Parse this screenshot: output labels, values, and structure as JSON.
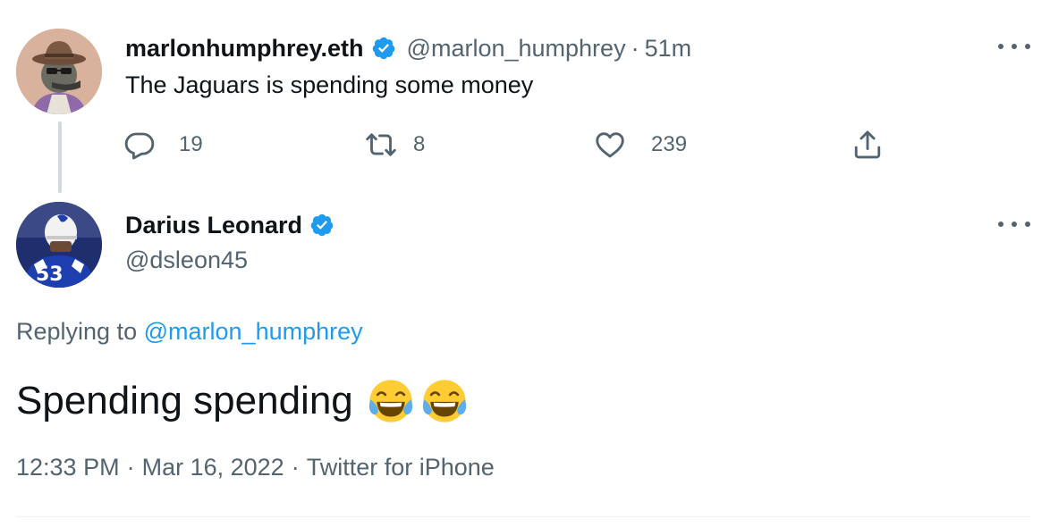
{
  "thread": {
    "parent_tweet": {
      "author_name": "marlonhumphrey.eth",
      "handle": "@marlon_humphrey",
      "separator": "·",
      "relative_time": "51m",
      "text": "The Jaguars is spending some money",
      "verified": true,
      "avatar_icon": "cartoon-avatar-cowboy-hat",
      "actions": {
        "reply_count": "19",
        "retweet_count": "8",
        "like_count": "239"
      }
    },
    "reply_tweet": {
      "author_name": "Darius Leonard",
      "handle": "@dsleon45",
      "verified": true,
      "avatar_icon": "player-photo-jersey-53",
      "avatar_jersey_number": "53",
      "replying_to_prefix": "Replying to",
      "replying_to_handle": "@marlon_humphrey",
      "text": "Spending spending",
      "emojis": [
        "face-with-tears-of-joy",
        "face-with-tears-of-joy"
      ],
      "meta": {
        "time": "12:33 PM",
        "separator1": "·",
        "date": "Mar 16, 2022",
        "separator2": "·",
        "source": "Twitter for iPhone"
      }
    }
  },
  "colors": {
    "primary_text": "#0f1419",
    "secondary_text": "#536471",
    "accent_blue": "#1d9bf0",
    "thread_line": "#cfd9de",
    "divider": "#eff3f4"
  }
}
